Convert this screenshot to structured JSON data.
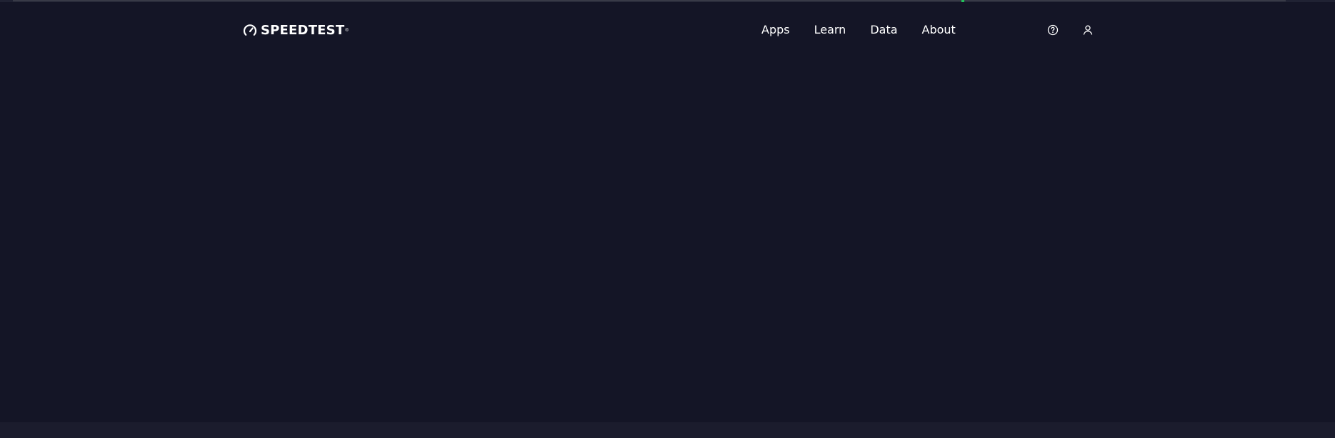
{
  "brand": {
    "logo_text": "SPEEDTEST",
    "trademark": "®",
    "icon": "speedometer-icon"
  },
  "nav": {
    "items": [
      {
        "label": "Apps"
      },
      {
        "label": "Learn"
      },
      {
        "label": "Data"
      },
      {
        "label": "About"
      }
    ]
  },
  "header_actions": {
    "help_icon": "help-circle-icon",
    "account_icon": "user-account-icon"
  },
  "page_load": {
    "progress": 0.72
  },
  "colors": {
    "background": "#141526",
    "bottom_band": "#1b1c2d",
    "text": "#ffffff",
    "accent": "#21c15a"
  }
}
